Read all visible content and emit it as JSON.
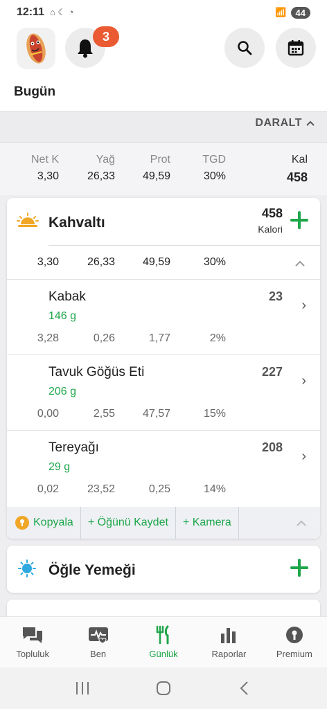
{
  "status_bar": {
    "time": "12:11",
    "battery": "44"
  },
  "header": {
    "notification_count": "3",
    "today_label": "Bugün"
  },
  "collapse": {
    "label": "DARALT"
  },
  "totals": {
    "columns": [
      {
        "label": "Net K",
        "value": "3,30"
      },
      {
        "label": "Yağ",
        "value": "26,33"
      },
      {
        "label": "Prot",
        "value": "49,59"
      },
      {
        "label": "TGD",
        "value": "30%"
      },
      {
        "label": "Kal",
        "value": "458"
      }
    ]
  },
  "breakfast": {
    "title": "Kahvaltı",
    "calories": "458",
    "calories_unit": "Kalori",
    "summary": [
      "3,30",
      "26,33",
      "49,59",
      "30%"
    ],
    "foods": [
      {
        "name": "Kabak",
        "amount": "146 g",
        "kcal": "23",
        "macros": [
          "3,28",
          "0,26",
          "1,77",
          "2%"
        ]
      },
      {
        "name": "Tavuk Göğüs Eti",
        "amount": "206 g",
        "kcal": "227",
        "macros": [
          "0,00",
          "2,55",
          "47,57",
          "15%"
        ]
      },
      {
        "name": "Tereyağı",
        "amount": "29 g",
        "kcal": "208",
        "macros": [
          "0,02",
          "23,52",
          "0,25",
          "14%"
        ]
      }
    ],
    "actions": {
      "copy": "Kopyala",
      "save_meal": "+ Öğünü Kaydet",
      "camera": "+ Kamera"
    }
  },
  "lunch": {
    "title": "Öğle Yemeği"
  },
  "bottom_nav": [
    {
      "label": "Topluluk",
      "icon": "chat-icon"
    },
    {
      "label": "Ben",
      "icon": "heart-pulse-icon"
    },
    {
      "label": "Günlük",
      "icon": "fork-knife-icon",
      "active": true
    },
    {
      "label": "Raporlar",
      "icon": "bar-chart-icon"
    },
    {
      "label": "Premium",
      "icon": "lock-icon"
    }
  ],
  "colors": {
    "accent_green": "#1ea64a",
    "badge": "#ea5a33",
    "sun": "#f0a727"
  }
}
